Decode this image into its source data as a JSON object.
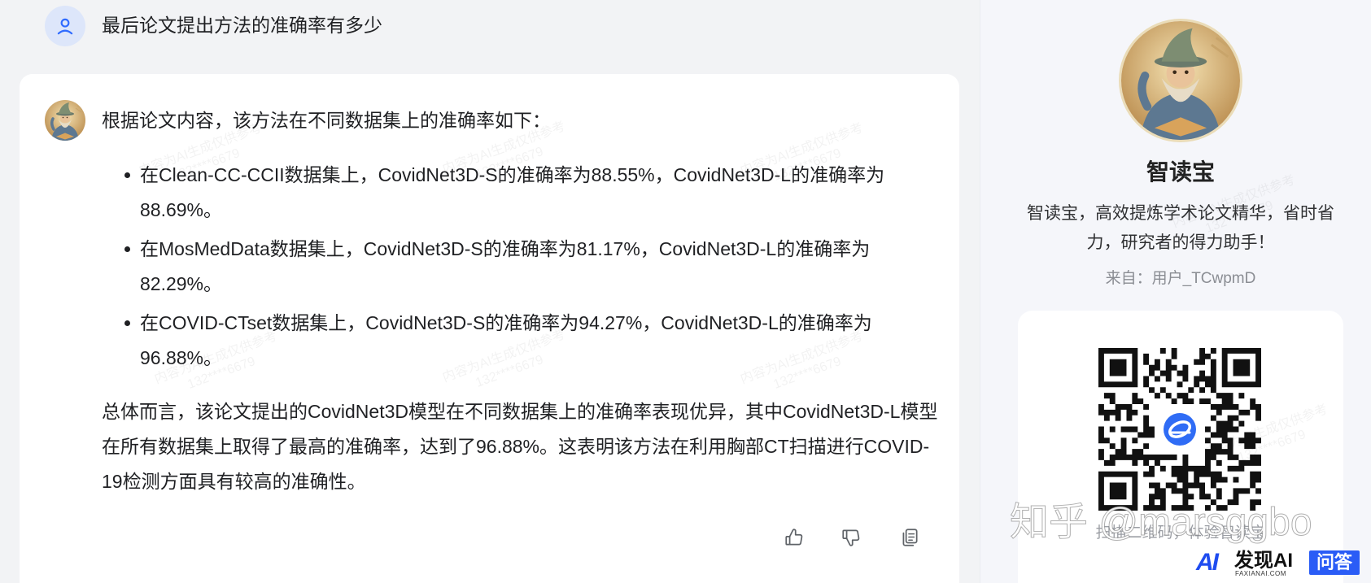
{
  "conversation": {
    "user": {
      "question": "最后论文提出方法的准确率有多少",
      "avatar_icon": "user-icon"
    },
    "answer": {
      "intro": "根据论文内容，该方法在不同数据集上的准确率如下：",
      "bullets": [
        "在Clean-CC-CCII数据集上，CovidNet3D-S的准确率为88.55%，CovidNet3D-L的准确率为88.69%。",
        "在MosMedData数据集上，CovidNet3D-S的准确率为81.17%，CovidNet3D-L的准确率为82.29%。",
        "在COVID-CTset数据集上，CovidNet3D-S的准确率为94.27%，CovidNet3D-L的准确率为96.88%。"
      ],
      "summary": "总体而言，该论文提出的CovidNet3D模型在不同数据集上的准确率表现优异，其中CovidNet3D-L模型在所有数据集上取得了最高的准确率，达到了96.88%。这表明该方法在利用胸部CT扫描进行COVID-19检测方面具有较高的准确性。"
    },
    "actions": {
      "like_icon": "thumbs-up-icon",
      "dislike_icon": "thumbs-down-icon",
      "copy_icon": "copy-icon"
    }
  },
  "watermark": {
    "notice": "内容为AI生成仅供参考",
    "user_id": "132****6679"
  },
  "bot_profile": {
    "name": "智读宝",
    "description": "智读宝，高效提炼学术论文精华，省时省力，研究者的得力助手！",
    "source": "来自：用户_TCwpmD",
    "qr_caption": "扫描二维码，体验智读宝"
  },
  "overlay": {
    "zhihu_watermark": "知乎 @marsggbo"
  },
  "brand": {
    "mark": "AI",
    "name": "发现AI",
    "domain": "FAXIANAI.COM",
    "badge": "问答"
  },
  "colors": {
    "page_bg": "#f2f3f5",
    "card_bg": "#ffffff",
    "side_bg": "#f5f6fa",
    "accent": "#2f6bff",
    "brand_blue": "#2a5cf6",
    "text": "#1f2023",
    "muted": "#8a8d93"
  }
}
